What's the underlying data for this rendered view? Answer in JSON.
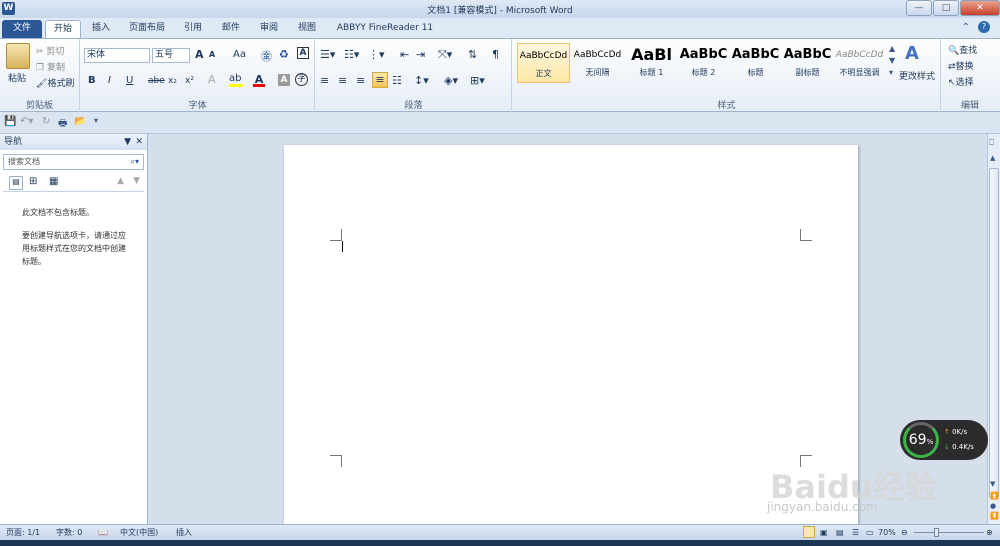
{
  "window": {
    "app_icon": "W",
    "title": "文档1 [兼容模式] - Microsoft Word",
    "controls": [
      "—",
      "□",
      "✕"
    ]
  },
  "tabs": [
    "文件",
    "开始",
    "插入",
    "页面布局",
    "引用",
    "邮件",
    "审阅",
    "视图",
    "ABBYY FineReader 11"
  ],
  "ribbon": {
    "clipboard": {
      "paste": "粘贴",
      "cut": "剪切",
      "copy": "复制",
      "format_painter": "格式刷",
      "label": "剪贴板"
    },
    "font": {
      "font_name": "宋体",
      "font_size": "五号",
      "grow": "A",
      "shrink": "A",
      "case": "Aa",
      "bold": "B",
      "italic": "I",
      "underline": "U",
      "strike": "abe",
      "subscript": "x₂",
      "superscript": "x²",
      "label": "字体"
    },
    "paragraph": {
      "label": "段落"
    },
    "styles": {
      "items": [
        {
          "preview": "AaBbCcDd",
          "label": "正文"
        },
        {
          "preview": "AaBbCcDd",
          "label": "无间隔"
        },
        {
          "preview": "AaBl",
          "label": "标题 1"
        },
        {
          "preview": "AaBbC",
          "label": "标题 2"
        },
        {
          "preview": "AaBbC",
          "label": "标题"
        },
        {
          "preview": "AaBbC",
          "label": "副标题"
        },
        {
          "preview": "AaBbCcDd",
          "label": "不明显强调"
        }
      ],
      "change_styles": "更改样式",
      "label": "样式"
    },
    "editing": {
      "find": "查找",
      "replace": "替换",
      "select": "选择",
      "label": "编辑"
    }
  },
  "nav_pane": {
    "title": "导航",
    "search_placeholder": "搜索文档",
    "message_line1": "此文档不包含标题。",
    "message_line2": "要创建导航选项卡，请通过应用标题样式在您的文档中创建标题。"
  },
  "status": {
    "page": "页面: 1/1",
    "words": "字数: 0",
    "language": "中文(中国)",
    "insert": "插入",
    "zoom": "70%"
  },
  "widget": {
    "percent": "69",
    "percent_unit": "%",
    "up": "0K/s",
    "down": "0.4K/s"
  },
  "watermark": {
    "brand": "Baidu经验",
    "url": "jingyan.baidu.com"
  }
}
